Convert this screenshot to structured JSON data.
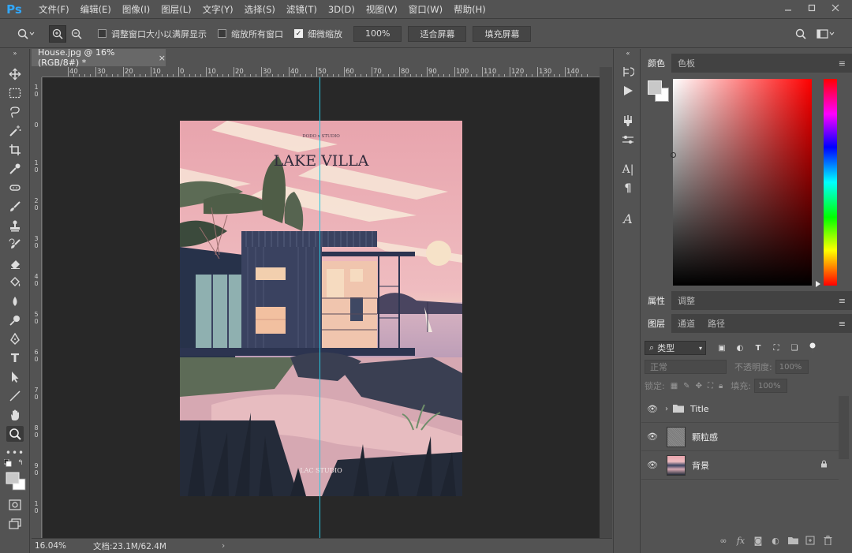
{
  "app": {
    "logo": "Ps",
    "menus": [
      "文件(F)",
      "编辑(E)",
      "图像(I)",
      "图层(L)",
      "文字(Y)",
      "选择(S)",
      "滤镜(T)",
      "3D(D)",
      "视图(V)",
      "窗口(W)",
      "帮助(H)"
    ],
    "window_controls": [
      "minimize-icon",
      "maximize-icon",
      "close-icon"
    ]
  },
  "options": {
    "resize_windows_label": "调整窗口大小以满屏显示",
    "resize_windows_checked": false,
    "zoom_all_label": "缩放所有窗口",
    "zoom_all_checked": false,
    "scrubby_label": "细微缩放",
    "scrubby_checked": true,
    "zoom_100_label": "100%",
    "fit_screen_label": "适合屏幕",
    "fill_screen_label": "填充屏幕"
  },
  "document": {
    "tab_title": "House.jpg @ 16%(RGB/8#) *",
    "close_symbol": "×",
    "zoom": "16.04%",
    "doc_size": "文档:23.1M/62.4M",
    "status_arrow": "›",
    "artwork_text": {
      "studio_top": "DODO x STUDIO",
      "title": "LAKE VILLA",
      "studio_bottom": "LAC STUDIO"
    }
  },
  "rulers": {
    "top_labels": [
      "40",
      "30",
      "20",
      "10",
      "0",
      "10",
      "20",
      "30",
      "40",
      "50",
      "60",
      "70",
      "80",
      "90",
      "100",
      "110",
      "120",
      "130",
      "140"
    ],
    "left_labels": [
      "1\n0",
      "0",
      "1\n0",
      "2\n0",
      "3\n0",
      "4\n0",
      "5\n0",
      "6\n0",
      "7\n0",
      "8\n0",
      "9\n0",
      "1\n0"
    ]
  },
  "panels": {
    "color_tabs": [
      "颜色",
      "色板"
    ],
    "properties_tabs": [
      "属性",
      "调整"
    ],
    "layers_tabs": [
      "图层",
      "通道",
      "路径"
    ],
    "kind_filter": "类型",
    "blend_mode": "正常",
    "opacity_label": "不透明度:",
    "opacity_value": "100%",
    "lock_label": "锁定:",
    "fill_label": "填充:",
    "fill_value": "100%",
    "layers": [
      {
        "name": "Title",
        "type": "group",
        "visible": true
      },
      {
        "name": "颗粒感",
        "type": "pixel",
        "visible": true
      },
      {
        "name": "背景",
        "type": "background",
        "visible": true,
        "locked": true
      }
    ],
    "footer_icons": [
      "link-icon",
      "fx-icon",
      "mask-icon",
      "adjustment-icon",
      "folder-icon",
      "new-layer-icon",
      "trash-icon"
    ]
  },
  "colors": {
    "accent": "#31a8ff",
    "guide": "#29c7e0",
    "foreground": "#c8c8c8",
    "background": "#ffffff"
  }
}
